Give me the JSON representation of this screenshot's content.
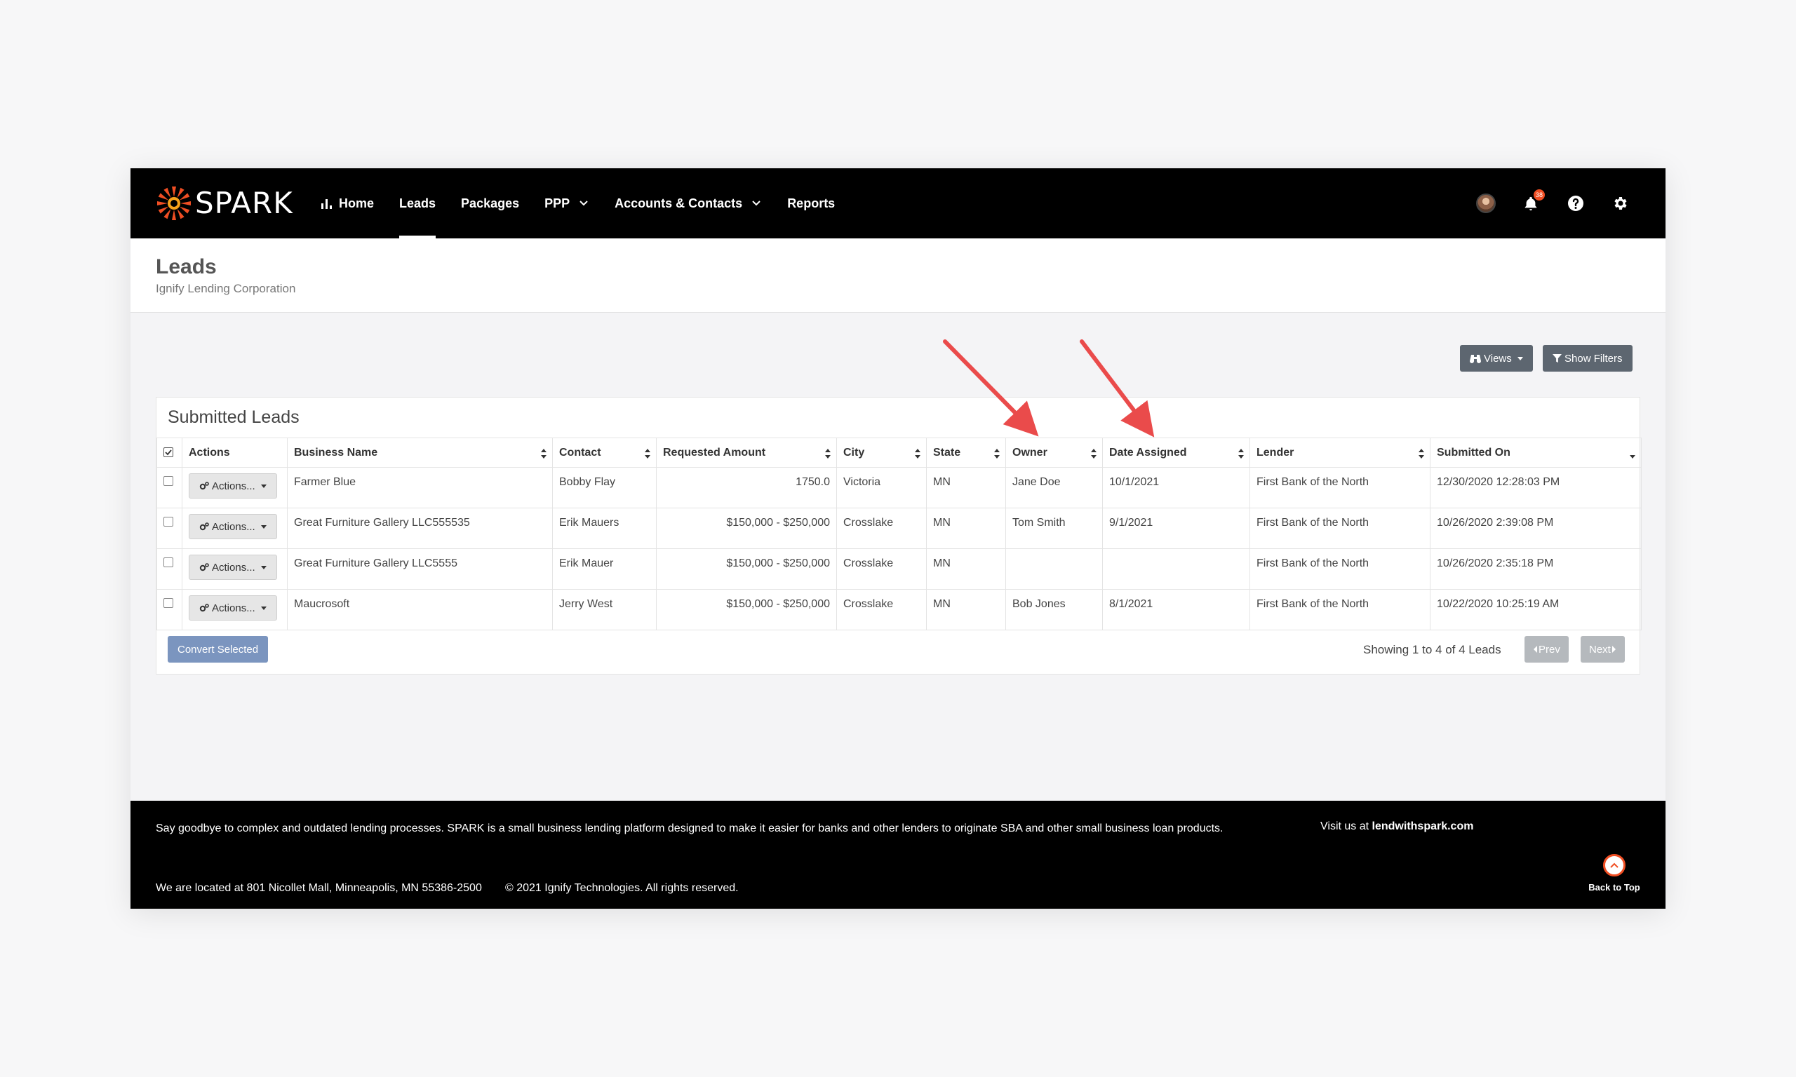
{
  "brand": {
    "name": "SPARK",
    "accent": "#f04e23"
  },
  "nav": {
    "items": [
      {
        "label": "Home",
        "icon": "bar-chart-icon"
      },
      {
        "label": "Leads",
        "active": true
      },
      {
        "label": "Packages"
      },
      {
        "label": "PPP",
        "dropdown": true
      },
      {
        "label": "Accounts & Contacts",
        "dropdown": true
      },
      {
        "label": "Reports"
      }
    ],
    "notification_count": "38"
  },
  "header": {
    "title": "Leads",
    "subtitle": "Ignify Lending Corporation"
  },
  "toolbar": {
    "views_label": "Views",
    "filters_label": "Show Filters"
  },
  "card": {
    "title": "Submitted Leads",
    "columns": [
      "Actions",
      "Business Name",
      "Contact",
      "Requested Amount",
      "City",
      "State",
      "Owner",
      "Date Assigned",
      "Lender",
      "Submitted On"
    ],
    "action_label": "Actions...",
    "rows": [
      {
        "business": "Farmer Blue",
        "contact": "Bobby Flay",
        "amount": "1750.0",
        "city": "Victoria",
        "state": "MN",
        "owner": "Jane Doe",
        "date_assigned": "10/1/2021",
        "lender": "First Bank of the North",
        "submitted": "12/30/2020 12:28:03 PM"
      },
      {
        "business": "Great Furniture Gallery LLC555535",
        "contact": "Erik Mauers",
        "amount": "$150,000 - $250,000",
        "city": "Crosslake",
        "state": "MN",
        "owner": "Tom Smith",
        "date_assigned": "9/1/2021",
        "lender": "First Bank of the North",
        "submitted": "10/26/2020 2:39:08 PM"
      },
      {
        "business": "Great Furniture Gallery LLC5555",
        "contact": "Erik Mauer",
        "amount": "$150,000 - $250,000",
        "city": "Crosslake",
        "state": "MN",
        "owner": "",
        "date_assigned": "",
        "lender": "First Bank of the North",
        "submitted": "10/26/2020 2:35:18 PM"
      },
      {
        "business": "Maucrosoft",
        "contact": "Jerry West",
        "amount": "$150,000 - $250,000",
        "city": "Crosslake",
        "state": "MN",
        "owner": "Bob Jones",
        "date_assigned": "8/1/2021",
        "lender": "First Bank of the North",
        "submitted": "10/22/2020 10:25:19 AM"
      }
    ],
    "convert_label": "Convert Selected",
    "showing_text": "Showing 1 to 4 of 4 Leads",
    "prev_label": "Prev",
    "next_label": "Next"
  },
  "footer": {
    "description": "Say goodbye to complex and outdated lending processes. SPARK is a small business lending platform designed to make it easier for banks and other lenders to originate SBA and other small business loan products.",
    "visit_prefix": "Visit us at",
    "visit_link": "lendwithspark.com",
    "location": "We are located at 801 Nicollet Mall, Minneapolis, MN 55386-2500",
    "copyright": "© 2021 Ignify Technologies. All rights reserved.",
    "back_to_top": "Back to Top"
  }
}
